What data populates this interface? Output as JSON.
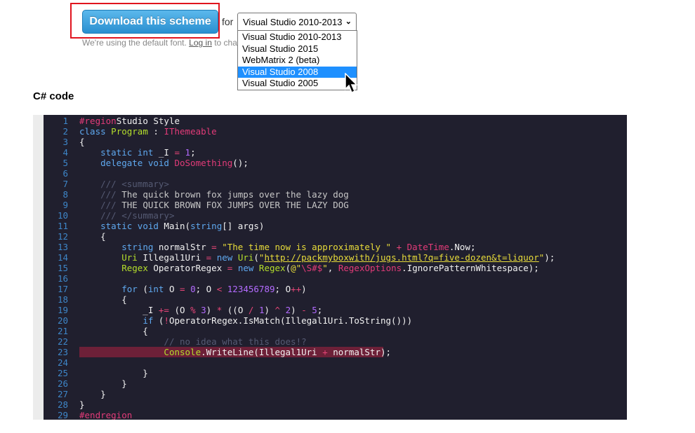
{
  "toolbar": {
    "download_label": "Download this scheme",
    "for_label": "for",
    "selected_version": "Visual Studio 2010-2013",
    "note_prefix": "We're using the default font.",
    "note_link": "Log in",
    "note_suffix": "to change it"
  },
  "dropdown": {
    "options": [
      "Visual Studio 2010-2013",
      "Visual Studio 2015",
      "WebMatrix 2 (beta)",
      "Visual Studio 2008",
      "Visual Studio 2005"
    ],
    "highlighted": "Visual Studio 2008"
  },
  "section": {
    "title": "C# code"
  },
  "colors": {
    "highlight_border": "#e0141e",
    "button": "#2a8fd0",
    "code_bg": "#201f2e",
    "keyword": "#5fa9f0",
    "type": "#b4de2c",
    "string": "#e8dc3a",
    "preprocessor": "#e23b78",
    "comment": "#555a73",
    "line_highlight": "#6d2038"
  },
  "code": {
    "highlighted_line": 23,
    "lines": [
      [
        [
          "pr",
          "#region"
        ],
        [
          "",
          "Studio Style"
        ]
      ],
      [
        [
          "kw",
          "class"
        ],
        [
          "",
          ""
        ],
        [
          "ty",
          "Program"
        ],
        [
          "",
          ":"
        ],
        [
          "pr",
          "IThemeable"
        ]
      ],
      [
        [
          "",
          "{"
        ]
      ],
      [
        [
          "",
          "    "
        ],
        [
          "kw",
          "static int"
        ],
        [
          "",
          " _I "
        ],
        [
          "op",
          "="
        ],
        [
          "",
          " "
        ],
        [
          "nm",
          "1"
        ],
        [
          "",
          ";"
        ]
      ],
      [
        [
          "",
          "    "
        ],
        [
          "kw",
          "delegate void"
        ],
        [
          "",
          " "
        ],
        [
          "pr",
          "DoSomething"
        ],
        [
          "",
          "();"
        ]
      ],
      [
        [
          "",
          ""
        ]
      ],
      [
        [
          "",
          "    "
        ],
        [
          "cm",
          "/// <summary>"
        ]
      ],
      [
        [
          "",
          "    "
        ],
        [
          "cm",
          "///"
        ],
        [
          "dm",
          " The quick brown fox jumps over the lazy dog"
        ]
      ],
      [
        [
          "",
          "    "
        ],
        [
          "cm",
          "///"
        ],
        [
          "dm",
          " THE QUICK BROWN FOX JUMPS OVER THE LAZY DOG"
        ]
      ],
      [
        [
          "",
          "    "
        ],
        [
          "cm",
          "/// </summary>"
        ]
      ],
      [
        [
          "",
          "    "
        ],
        [
          "kw",
          "static void"
        ],
        [
          "",
          " Main("
        ],
        [
          "kw",
          "string"
        ],
        [
          "",
          "[] args)"
        ]
      ],
      [
        [
          "",
          "    {"
        ]
      ],
      [
        [
          "",
          "        "
        ],
        [
          "kw",
          "string"
        ],
        [
          "",
          " normalStr "
        ],
        [
          "op",
          "="
        ],
        [
          "",
          " "
        ],
        [
          "st",
          "\"The time now is approximately \""
        ],
        [
          "",
          " "
        ],
        [
          "op",
          "+"
        ],
        [
          "",
          " "
        ],
        [
          "pr",
          "DateTime"
        ],
        [
          "",
          ".Now;"
        ]
      ],
      [
        [
          "",
          "        "
        ],
        [
          "ty",
          "Uri"
        ],
        [
          "",
          " Illegal1Uri "
        ],
        [
          "op",
          "="
        ],
        [
          "",
          " "
        ],
        [
          "kw",
          "new"
        ],
        [
          "",
          " "
        ],
        [
          "ty",
          "Uri"
        ],
        [
          "",
          "("
        ],
        [
          "st",
          "\""
        ],
        [
          "link",
          "http://packmyboxwith/jugs.html?q=five-dozen&t=liquor"
        ],
        [
          "st",
          "\""
        ],
        [
          "",
          ");"
        ]
      ],
      [
        [
          "",
          "        "
        ],
        [
          "ty",
          "Regex"
        ],
        [
          "",
          " OperatorRegex "
        ],
        [
          "op",
          "="
        ],
        [
          "",
          " "
        ],
        [
          "kw",
          "new"
        ],
        [
          "",
          " "
        ],
        [
          "ty",
          "Regex"
        ],
        [
          "",
          "("
        ],
        [
          "st",
          "@\""
        ],
        [
          "pr",
          "\\S#$"
        ],
        [
          "st",
          "\""
        ],
        [
          "",
          ", "
        ],
        [
          "pr",
          "RegexOptions"
        ],
        [
          "",
          ".IgnorePatternWhitespace);"
        ]
      ],
      [
        [
          "",
          ""
        ]
      ],
      [
        [
          "",
          "        "
        ],
        [
          "kw",
          "for"
        ],
        [
          "",
          " ("
        ],
        [
          "kw",
          "int"
        ],
        [
          "",
          " O "
        ],
        [
          "op",
          "="
        ],
        [
          "",
          " "
        ],
        [
          "nm",
          "0"
        ],
        [
          "",
          "; O "
        ],
        [
          "op",
          "<"
        ],
        [
          "",
          " "
        ],
        [
          "nm",
          "123456789"
        ],
        [
          "",
          "; O"
        ],
        [
          "op",
          "++"
        ],
        [
          "",
          ")"
        ]
      ],
      [
        [
          "",
          "        {"
        ]
      ],
      [
        [
          "",
          "            _I "
        ],
        [
          "op",
          "+="
        ],
        [
          "",
          " (O "
        ],
        [
          "op",
          "%"
        ],
        [
          "",
          " "
        ],
        [
          "nm",
          "3"
        ],
        [
          "",
          ") "
        ],
        [
          "op",
          "*"
        ],
        [
          "",
          " ((O "
        ],
        [
          "op",
          "/"
        ],
        [
          "",
          " "
        ],
        [
          "nm",
          "1"
        ],
        [
          "",
          ") "
        ],
        [
          "op",
          "^"
        ],
        [
          "",
          " "
        ],
        [
          "nm",
          "2"
        ],
        [
          "",
          ") "
        ],
        [
          "op",
          "-"
        ],
        [
          "",
          " "
        ],
        [
          "nm",
          "5"
        ],
        [
          "",
          ";"
        ]
      ],
      [
        [
          "",
          "            "
        ],
        [
          "kw",
          "if"
        ],
        [
          "",
          " ("
        ],
        [
          "op",
          "!"
        ],
        [
          "",
          "OperatorRegex.IsMatch(Illegal1Uri.ToString()))"
        ]
      ],
      [
        [
          "",
          "            {"
        ]
      ],
      [
        [
          "",
          "                "
        ],
        [
          "cm",
          "// no idea what this does!?"
        ]
      ],
      [
        [
          "",
          "                "
        ],
        [
          "ty",
          "Console"
        ],
        [
          "",
          ".WriteLine(Illegal1Uri "
        ],
        [
          "op",
          "+"
        ],
        [
          "",
          " normalStr);"
        ]
      ],
      [
        [
          "",
          ""
        ]
      ],
      [
        [
          "",
          "            }"
        ]
      ],
      [
        [
          "",
          "        }"
        ]
      ],
      [
        [
          "",
          "    }"
        ]
      ],
      [
        [
          "",
          "}"
        ]
      ],
      [
        [
          "pr",
          "#endregion"
        ]
      ]
    ]
  }
}
